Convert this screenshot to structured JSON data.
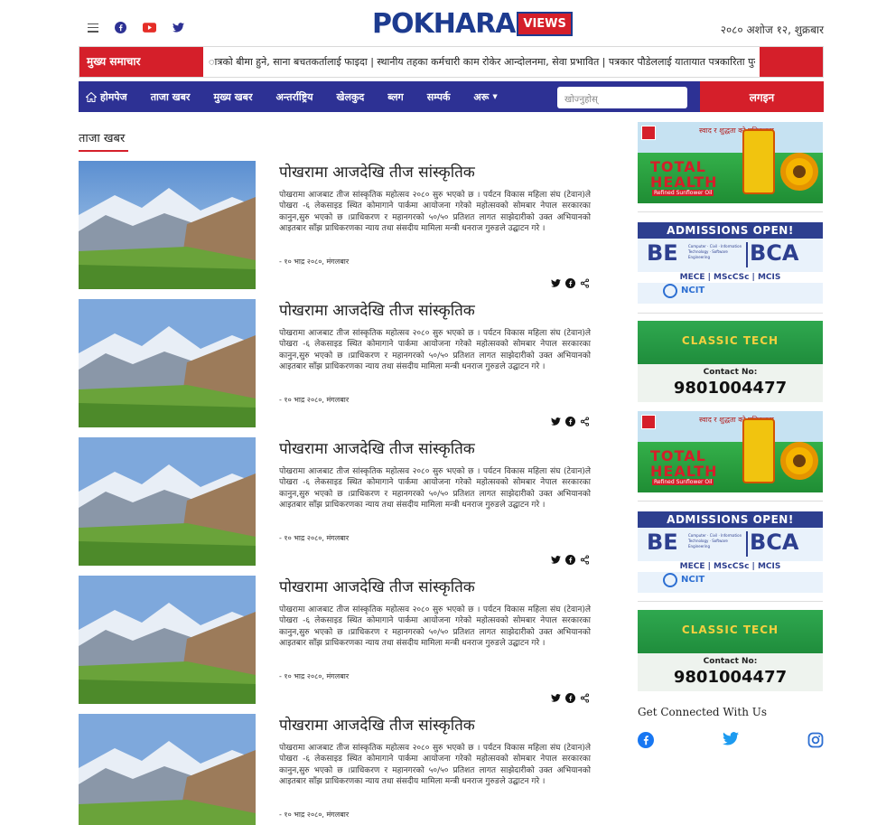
{
  "header": {
    "logo_main": "POKHARA",
    "logo_sub": "VIEWS",
    "date": "२०८० अशोज १२, शुक्रबार"
  },
  "breaking": {
    "label": "मुख्य समाचार",
    "ticker": "ात्रको बीमा हुने, साना बचतकर्तालाई फाइदा  |  स्थानीय तहका कर्मचारी काम रोकेर आन्दोलनमा, सेवा प्रभावित  |  पत्रकार पौडेललाई यातायात पत्रकारिता पुरस्का"
  },
  "nav": {
    "items": [
      "होमपेज",
      "ताजा खबर",
      "मुख्य खबर",
      "अन्तर्राष्ट्रिय",
      "खेलकुद",
      "ब्लग",
      "सम्पर्क",
      "अरू"
    ],
    "search_placeholder": "खोज्नुहोस्",
    "login": "लगइन"
  },
  "section": {
    "title": "ताजा खबर"
  },
  "articles": [
    {
      "title": "पोखरामा आजदेखि तीज सांस्कृतिक",
      "excerpt": "पोखरामा आजबाट तीज सांस्कृतिक महोत्सव २०८० सुरु भएको छ । पर्यटन विकास महिला संघ (टेवान)ले पोखरा -६ लेकसाइड स्थित कोमागाने पार्कमा आयोजना गरेको महोत्सवको सोमबार नेपाल सरकारका कानुन,सुरु भएको छ ।प्राधिकरण र महानगरको ५०/५० प्रतिशत लागत साझेदारीको उक्त अभियानको आइतबार साँझ प्राधिकरणका न्याय तथा संसदीय मामिला मन्त्री धनराज गुरुङले उद्घाटन गरे ।",
      "meta": "- १० भाद्र २०८०, मंगलबार"
    },
    {
      "title": "पोखरामा आजदेखि तीज सांस्कृतिक",
      "excerpt": "पोखरामा आजबाट तीज सांस्कृतिक महोत्सव २०८० सुरु भएको छ । पर्यटन विकास महिला संघ (टेवान)ले पोखरा -६ लेकसाइड स्थित कोमागाने पार्कमा आयोजना गरेको महोत्सवको सोमबार नेपाल सरकारका कानुन,सुरु भएको छ ।प्राधिकरण र महानगरको ५०/५० प्रतिशत लागत साझेदारीको उक्त अभियानको आइतबार साँझ प्राधिकरणका न्याय तथा संसदीय मामिला मन्त्री धनराज गुरुङले उद्घाटन गरे ।",
      "meta": "- १० भाद्र २०८०, मंगलबार"
    },
    {
      "title": "पोखरामा आजदेखि तीज सांस्कृतिक",
      "excerpt": "पोखरामा आजबाट तीज सांस्कृतिक महोत्सव २०८० सुरु भएको छ । पर्यटन विकास महिला संघ (टेवान)ले पोखरा -६ लेकसाइड स्थित कोमागाने पार्कमा आयोजना गरेको महोत्सवको सोमबार नेपाल सरकारका कानुन,सुरु भएको छ ।प्राधिकरण र महानगरको ५०/५० प्रतिशत लागत साझेदारीको उक्त अभियानको आइतबार साँझ प्राधिकरणका न्याय तथा संसदीय मामिला मन्त्री धनराज गुरुङले उद्घाटन गरे ।",
      "meta": "- १० भाद्र २०८०, मंगलबार"
    },
    {
      "title": "पोखरामा आजदेखि तीज सांस्कृतिक",
      "excerpt": "पोखरामा आजबाट तीज सांस्कृतिक महोत्सव २०८० सुरु भएको छ । पर्यटन विकास महिला संघ (टेवान)ले पोखरा -६ लेकसाइड स्थित कोमागाने पार्कमा आयोजना गरेको महोत्सवको सोमबार नेपाल सरकारका कानुन,सुरु भएको छ ।प्राधिकरण र महानगरको ५०/५० प्रतिशत लागत साझेदारीको उक्त अभियानको आइतबार साँझ प्राधिकरणका न्याय तथा संसदीय मामिला मन्त्री धनराज गुरुङले उद्घाटन गरे ।",
      "meta": "- १० भाद्र २०८०, मंगलबार"
    },
    {
      "title": "पोखरामा आजदेखि तीज सांस्कृतिक",
      "excerpt": "पोखरामा आजबाट तीज सांस्कृतिक महोत्सव २०८० सुरु भएको छ । पर्यटन विकास महिला संघ (टेवान)ले पोखरा -६ लेकसाइड स्थित कोमागाने पार्कमा आयोजना गरेको महोत्सवको सोमबार नेपाल सरकारका कानुन,सुरु भएको छ ।प्राधिकरण र महानगरको ५०/५० प्रतिशत लागत साझेदारीको उक्त अभियानको आइतबार साँझ प्राधिकरणका न्याय तथा संसदीय मामिला मन्त्री धनराज गुरुङले उद्घाटन गरे ।",
      "meta": "- १० भाद्र २०८०, मंगलबार"
    }
  ],
  "ads": {
    "health": {
      "tagline": "स्वाद र शुद्धता को प्रतिबद्धता",
      "brand_line1": "TOTAL",
      "brand_line2": "HEALTH",
      "sub": "Refined Sunflower Oil"
    },
    "ncit": {
      "header": "ADMISSIONS OPEN!",
      "be": "BE",
      "bca": "BCA",
      "be_programs": "Computer · Civil · Information Technology · Software Engineering",
      "programs": "MECE | MScCSc | MCIS",
      "name": "NCIT"
    },
    "classic": {
      "brand": "CLASSIC TECH",
      "contact_label": "Contact No:",
      "phone": "9801004477"
    }
  },
  "connect": {
    "title": "Get Connected With Us"
  },
  "colors": {
    "brand_red": "#d51f2a",
    "nav_blue": "#2d3194",
    "facebook": "#1877f2",
    "twitter": "#1da1f2",
    "instagram": "#2d6fd2",
    "youtube": "#ff0000"
  },
  "icons": [
    "menu-icon",
    "facebook-icon",
    "youtube-icon",
    "twitter-icon",
    "home-icon",
    "share-icon",
    "instagram-icon"
  ]
}
